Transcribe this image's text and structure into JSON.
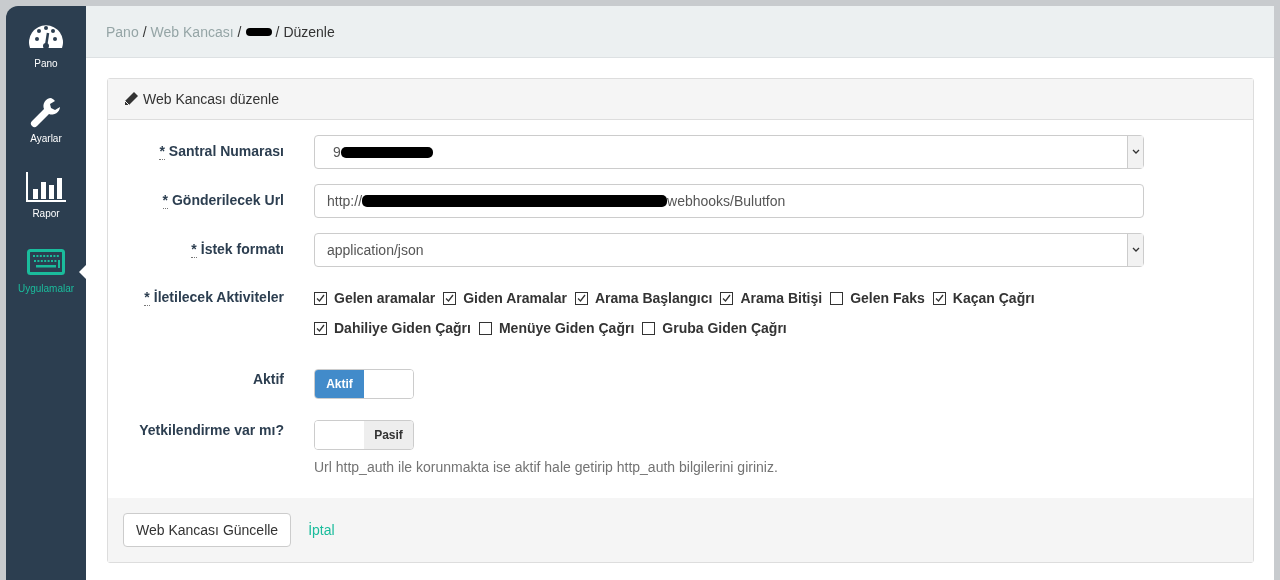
{
  "sidebar": {
    "items": [
      {
        "kind": "gauge",
        "label": "Pano",
        "selected": false
      },
      {
        "kind": "wrench",
        "label": "Ayarlar",
        "selected": false
      },
      {
        "kind": "chart",
        "label": "Rapor",
        "selected": false
      },
      {
        "kind": "keyboard",
        "label": "Uygulamalar",
        "selected": true
      }
    ]
  },
  "breadcrumb": {
    "items": [
      {
        "kind": "link",
        "label": "Pano"
      },
      {
        "kind": "link",
        "label": "Web Kancası"
      },
      {
        "kind": "redacted"
      },
      {
        "kind": "current",
        "label": "Düzenle"
      }
    ],
    "separator": "/"
  },
  "card": {
    "title": "Web Kancası düzenle",
    "fields": [
      {
        "kind": "select",
        "required": "*",
        "label": "Santral Numarası",
        "value_prefix": "9",
        "redacted": true
      },
      {
        "kind": "text",
        "required": "*",
        "label": "Gönderilecek Url",
        "value_prefix": "http://",
        "redacted": true,
        "value_suffix": "webhooks/Bulutfon"
      },
      {
        "kind": "select",
        "required": "*",
        "label": "İstek formatı",
        "value_prefix": "application/json"
      },
      {
        "kind": "checkboxes",
        "required": "*",
        "label": "İletilecek Aktiviteler",
        "options": [
          {
            "label": "Gelen aramalar",
            "checked": true
          },
          {
            "label": "Giden Aramalar",
            "checked": true
          },
          {
            "label": "Arama Başlangıcı",
            "checked": true
          },
          {
            "label": "Arama Bitişi",
            "checked": true
          },
          {
            "label": "Gelen Faks",
            "checked": false
          },
          {
            "label": "Kaçan Çağrı",
            "checked": true
          },
          {
            "label": "Dahiliye Giden Çağrı",
            "checked": true
          },
          {
            "label": "Menüye Giden Çağrı",
            "checked": false
          },
          {
            "label": "Gruba Giden Çağrı",
            "checked": false
          }
        ]
      },
      {
        "kind": "toggle",
        "label": "Aktif",
        "on": true,
        "switch_label": "Aktif"
      },
      {
        "kind": "toggle",
        "label": "Yetkilendirme var mı?",
        "on": false,
        "switch_label": "Pasif",
        "help": "Url http_auth ile korunmakta ise aktif hale getirip http_auth bilgilerini giriniz."
      }
    ],
    "buttons": [
      {
        "kind": "button",
        "label": "Web Kancası Güncelle"
      },
      {
        "kind": "link",
        "label": "İptal"
      }
    ]
  }
}
